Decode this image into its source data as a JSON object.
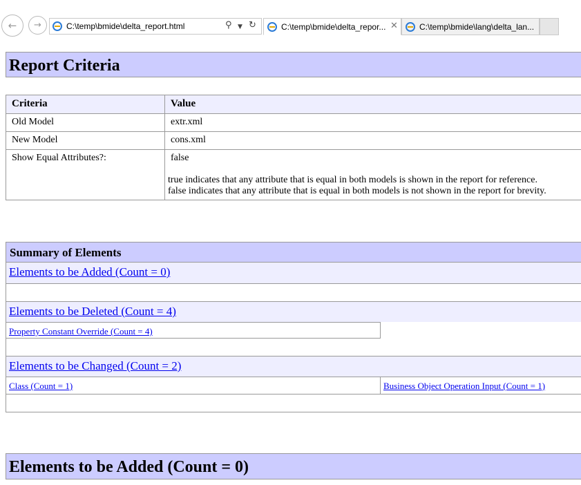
{
  "browser": {
    "address": "C:\\temp\\bmide\\delta_report.html",
    "tabs": [
      {
        "title": "C:\\temp\\bmide\\delta_repor..."
      },
      {
        "title": "C:\\temp\\bmide\\lang\\delta_lan..."
      }
    ]
  },
  "report": {
    "title": "Report Criteria",
    "criteria_header": "Criteria",
    "value_header": "Value",
    "rows": [
      {
        "criteria": "Old Model",
        "value": "extr.xml"
      },
      {
        "criteria": "New Model",
        "value": "cons.xml"
      },
      {
        "criteria": "Show Equal Attributes?:",
        "value": "false",
        "desc1": "true indicates that any attribute that is equal in both models is shown in the report for reference.",
        "desc2": "false indicates that any attribute that is equal in both models is not shown in the report for brevity."
      }
    ]
  },
  "summary": {
    "title": "Summary of Elements",
    "added": "Elements to be Added (Count = 0)",
    "deleted": "Elements to be Deleted (Count = 4)",
    "deleted_items": [
      "Property Constant Override (Count = 4)"
    ],
    "changed": "Elements to be Changed (Count = 2)",
    "changed_items": [
      "Class (Count = 1)",
      "Business Object Operation Input (Count = 1)"
    ]
  },
  "section_added": {
    "title": "Elements to be Added (Count = 0)"
  }
}
